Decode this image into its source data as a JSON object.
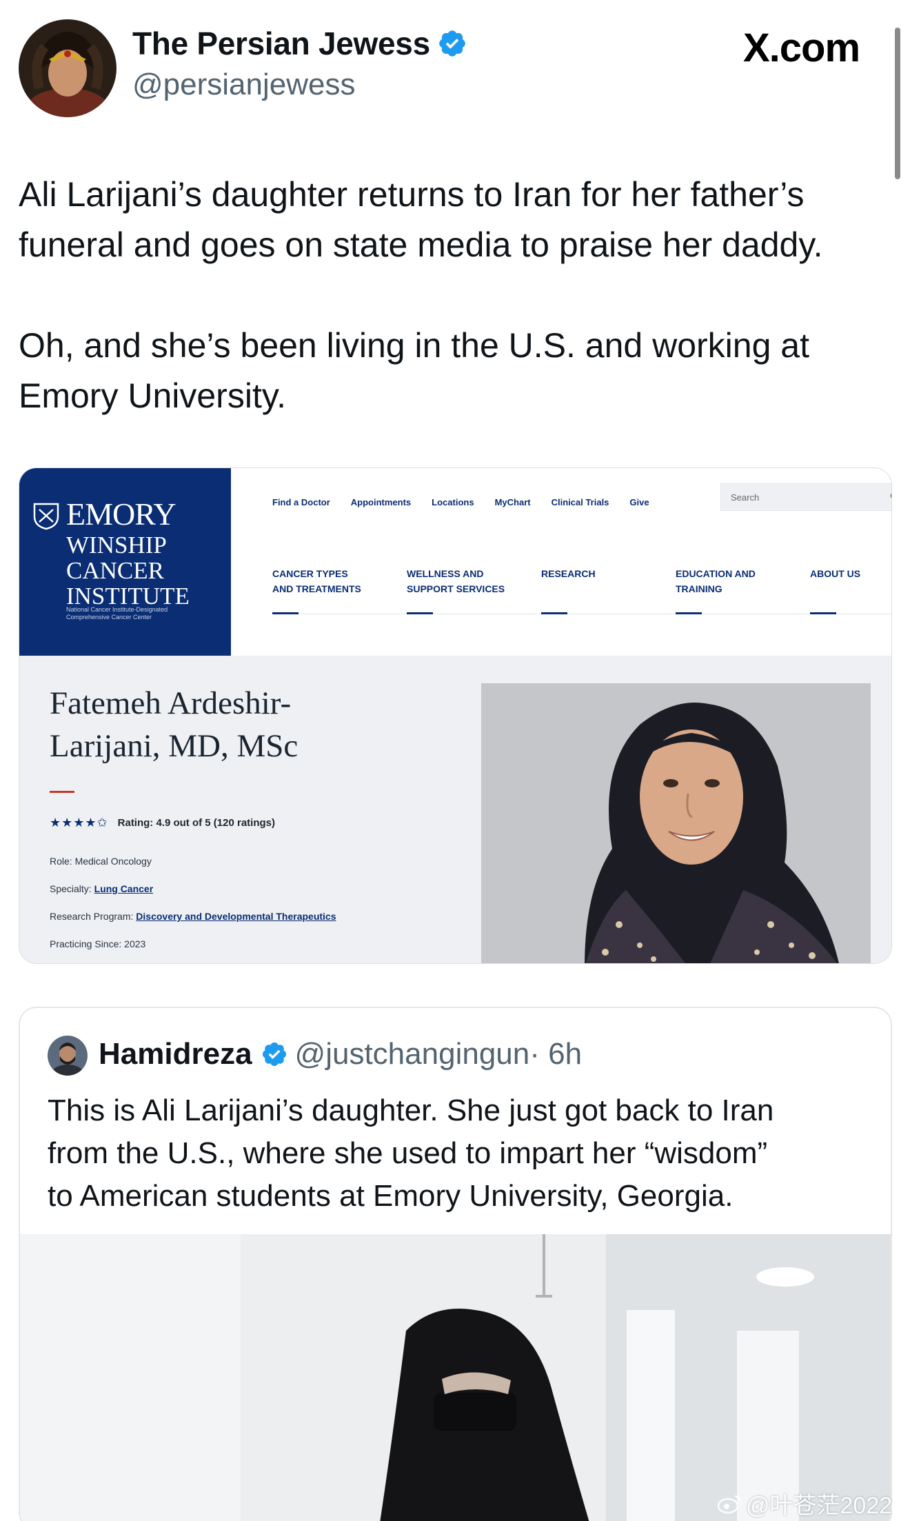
{
  "post": {
    "author_name": "The Persian Jewess",
    "author_handle": "@persianjewess",
    "site_label": "X.com",
    "text_paragraphs": [
      "Ali Larijani’s daughter returns to Iran for her father’s\nfuneral and goes on state media to praise her daddy.",
      "Oh, and she’s been living in the U.S. and working at\nEmory University."
    ]
  },
  "media1": {
    "logo": {
      "word": "EMORY",
      "sub": "WINSHIP\nCANCER\nINSTITUTE",
      "fine": "National Cancer Institute-Designated Comprehensive Cancer Center"
    },
    "utility_nav": [
      "Find a Doctor",
      "Appointments",
      "Locations",
      "MyChart",
      "Clinical Trials",
      "Give"
    ],
    "search_placeholder": "Search",
    "main_nav": [
      "CANCER TYPES\nAND TREATMENTS",
      "WELLNESS AND\nSUPPORT SERVICES",
      "RESEARCH",
      "EDUCATION AND\nTRAINING",
      "ABOUT US"
    ],
    "doctor_name": "Fatemeh Ardeshir-\nLarijani, MD, MSc",
    "stars": "★★★★✩",
    "rating_text": "Rating: 4.9 out of 5 (120 ratings)",
    "role_label": "Role: Medical Oncology",
    "specialty_label": "Specialty:",
    "specialty_value": "Lung Cancer",
    "program_label": "Research Program:",
    "program_value": "Discovery and Developmental Therapeutics",
    "practicing_since": "Practicing Since: 2023"
  },
  "quote": {
    "name": "Hamidreza",
    "handle": "@justchangingun",
    "time": "· 6h",
    "text": "This is Ali Larijani’s daughter. She just got back to Iran\nfrom the U.S., where she used to impart her “wisdom”\nto American students at Emory University, Georgia."
  },
  "watermark": "@叶苍茫2022",
  "colors": {
    "verified_blue": "#1d9bf0",
    "emory_navy": "#0a2d74",
    "handle_gray": "#536471"
  },
  "icons": [
    "verified-badge-icon",
    "search-icon",
    "shield-icon",
    "weibo-icon"
  ]
}
